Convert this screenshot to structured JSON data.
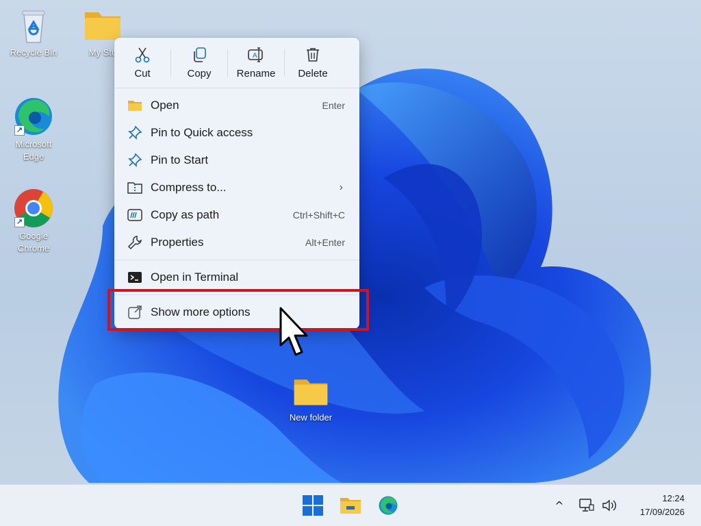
{
  "desktop": {
    "icons": [
      {
        "label": "Recycle Bin"
      },
      {
        "label": "My Stu"
      },
      {
        "label": "Microsoft Edge"
      },
      {
        "label": "Google Chrome"
      },
      {
        "label": "New folder"
      }
    ]
  },
  "context_menu": {
    "quick_actions": [
      {
        "label": "Cut",
        "icon": "scissors-icon"
      },
      {
        "label": "Copy",
        "icon": "copy-icon"
      },
      {
        "label": "Rename",
        "icon": "rename-icon"
      },
      {
        "label": "Delete",
        "icon": "trash-icon"
      }
    ],
    "items": [
      {
        "label": "Open",
        "shortcut": "Enter",
        "icon": "folder-icon"
      },
      {
        "label": "Pin to Quick access",
        "shortcut": "",
        "icon": "pin-icon"
      },
      {
        "label": "Pin to Start",
        "shortcut": "",
        "icon": "pin-icon"
      },
      {
        "label": "Compress to...",
        "shortcut": "",
        "icon": "zip-folder-icon",
        "submenu_arrow": "›"
      },
      {
        "label": "Copy as path",
        "shortcut": "Ctrl+Shift+C",
        "icon": "path-icon"
      },
      {
        "label": "Properties",
        "shortcut": "Alt+Enter",
        "icon": "wrench-icon"
      },
      {
        "label": "Open in Terminal",
        "shortcut": "",
        "icon": "terminal-icon"
      },
      {
        "label": "Show more options",
        "shortcut": "",
        "icon": "external-icon"
      }
    ]
  },
  "taskbar": {
    "clock": {
      "time": "12:24",
      "date": "17/09/2026"
    },
    "tray_chevron": "^"
  },
  "colors": {
    "highlight": "#d4121b",
    "folder": "#f7c948",
    "accent": "#1a5fd1"
  }
}
